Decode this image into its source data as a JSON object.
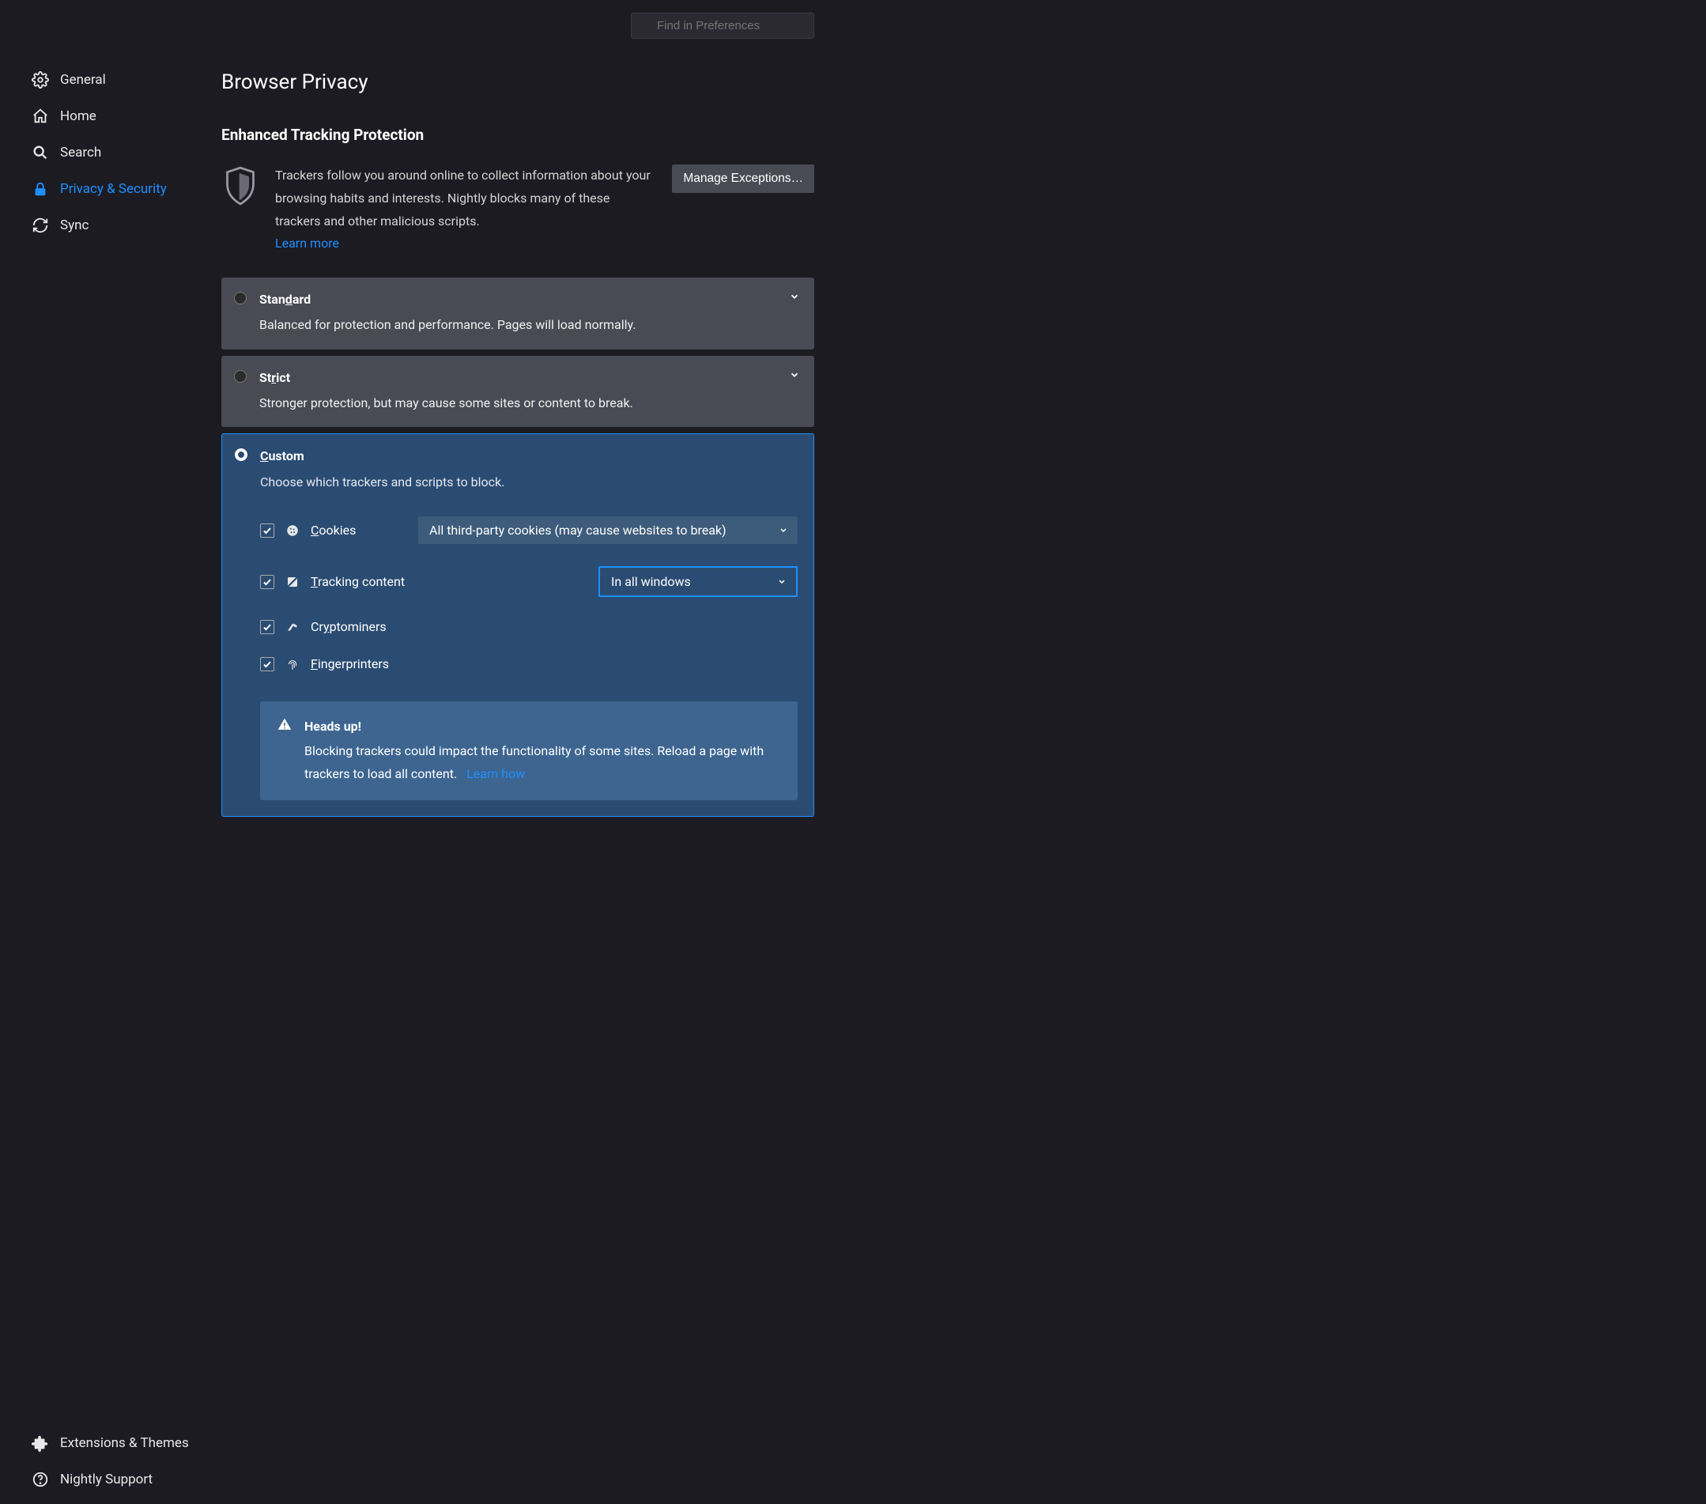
{
  "search": {
    "placeholder": "Find in Preferences"
  },
  "sidebar": {
    "items": [
      {
        "label": "General"
      },
      {
        "label": "Home"
      },
      {
        "label": "Search"
      },
      {
        "label": "Privacy & Security"
      },
      {
        "label": "Sync"
      }
    ],
    "bottom": [
      {
        "label": "Extensions & Themes"
      },
      {
        "label": "Nightly Support"
      }
    ]
  },
  "page": {
    "title": "Browser Privacy",
    "section_title": "Enhanced Tracking Protection",
    "intro": "Trackers follow you around online to collect information about your browsing habits and interests. Nightly blocks many of these trackers and other malicious scripts.",
    "learn_more": "Learn more",
    "manage_exceptions": "Manage Exceptions…"
  },
  "etp": {
    "standard": {
      "title": "Standard",
      "desc": "Balanced for protection and performance. Pages will load normally."
    },
    "strict": {
      "title": "Strict",
      "desc": "Stronger protection, but may cause some sites or content to break."
    },
    "custom": {
      "title": "Custom",
      "desc": "Choose which trackers and scripts to block.",
      "cookies_label": "Cookies",
      "cookies_value": "All third-party cookies (may cause websites to break)",
      "tracking_label": "Tracking content",
      "tracking_value": "In all windows",
      "crypto_label": "Cryptominers",
      "fp_label": "Fingerprinters"
    }
  },
  "callout": {
    "heading": "Heads up!",
    "body": "Blocking trackers could impact the functionality of some sites. Reload a page with trackers to load all content.",
    "learn_how": "Learn how"
  }
}
